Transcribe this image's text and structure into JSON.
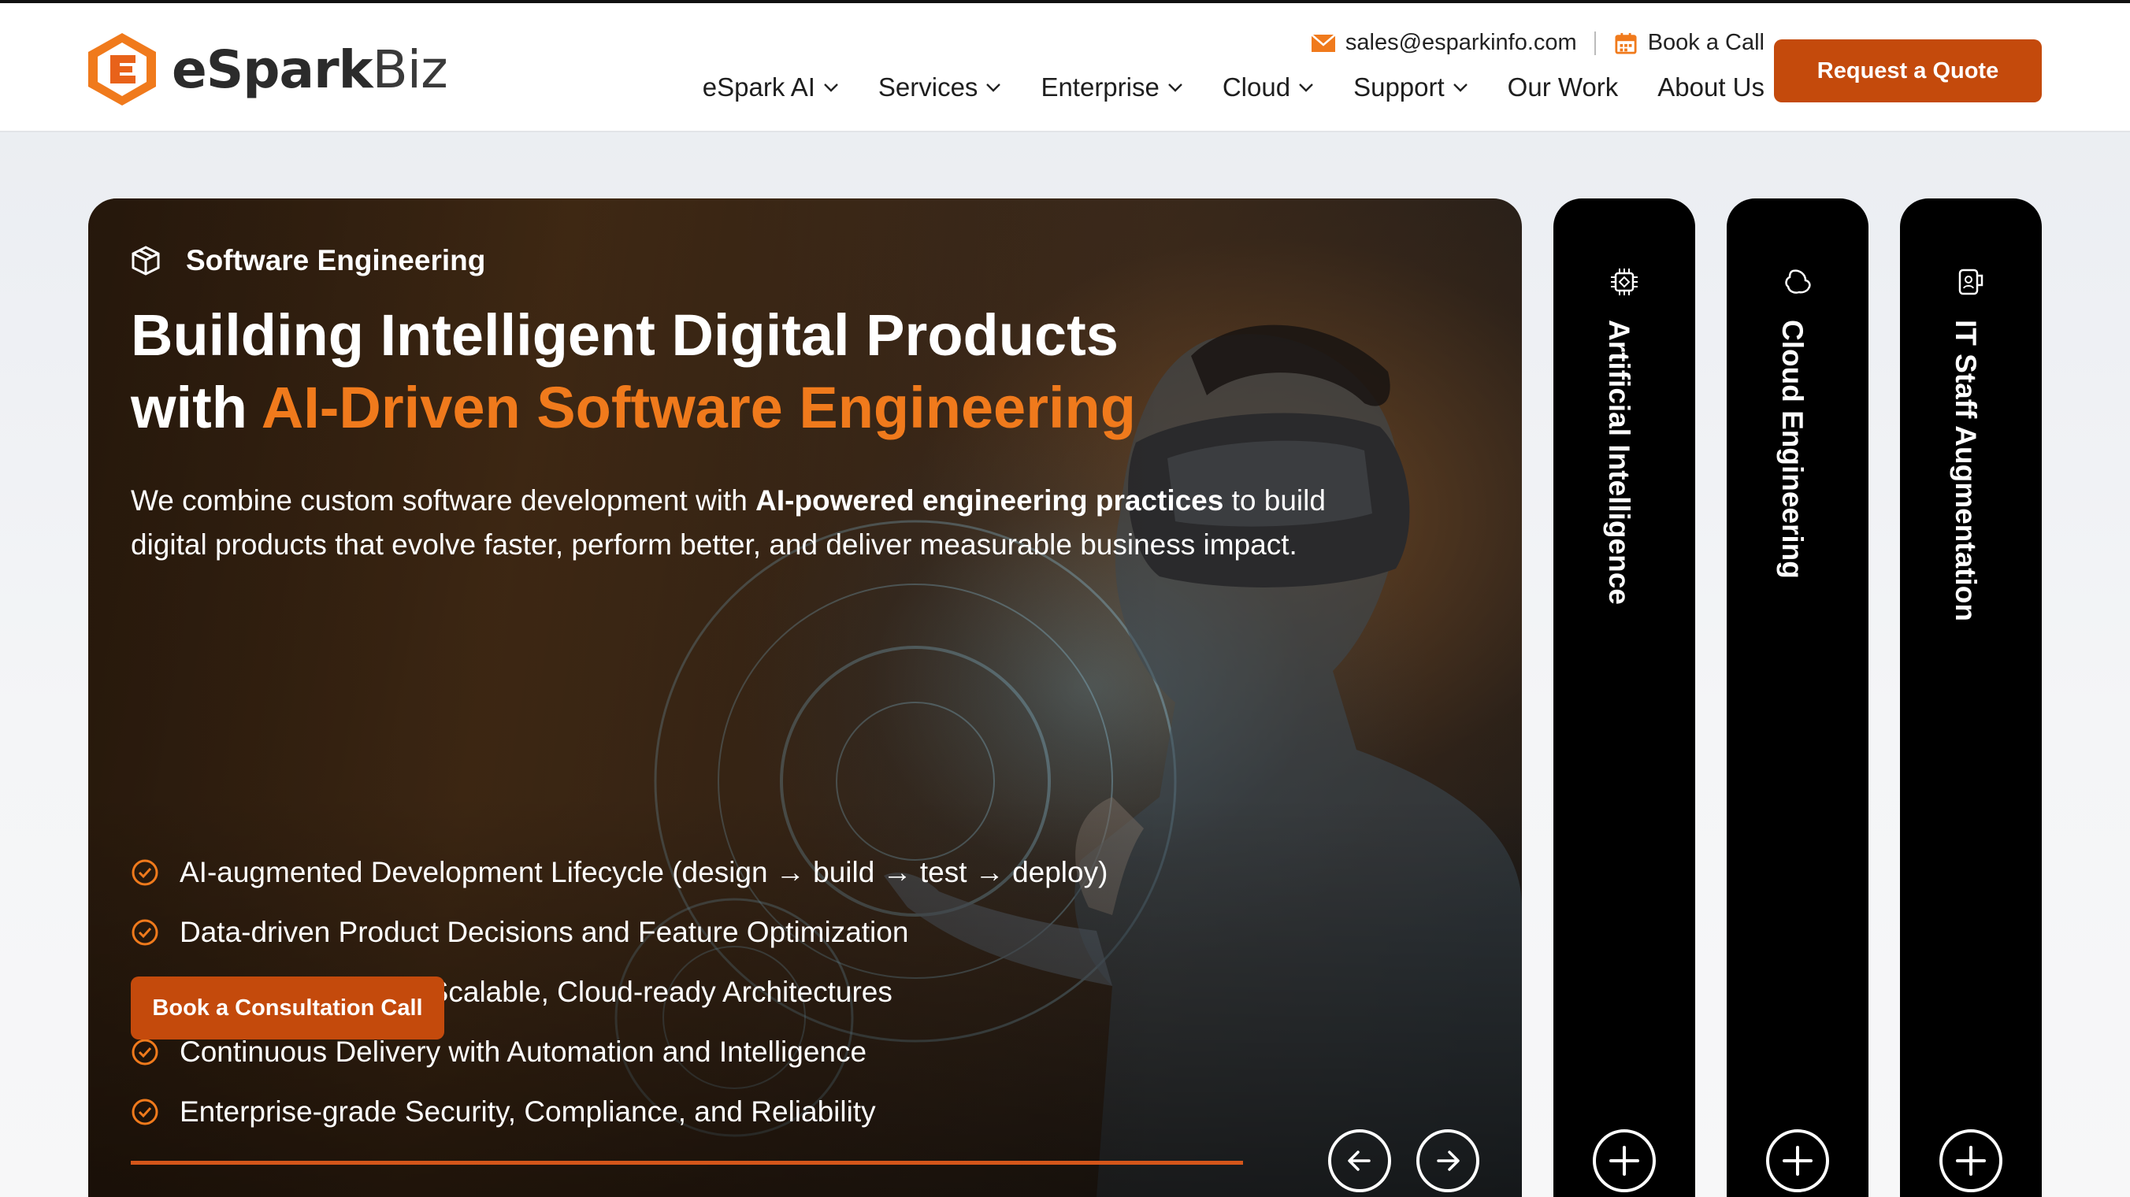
{
  "brand": {
    "name_main": "eSpark",
    "name_suffix": "Biz",
    "accent": "#f07a1c",
    "button_color": "#c44a0c"
  },
  "header": {
    "email": "sales@esparkinfo.com",
    "book_call": "Book a Call",
    "nav": [
      {
        "label": "eSpark AI",
        "dropdown": true
      },
      {
        "label": "Services",
        "dropdown": true
      },
      {
        "label": "Enterprise",
        "dropdown": true
      },
      {
        "label": "Cloud",
        "dropdown": true
      },
      {
        "label": "Support",
        "dropdown": true
      },
      {
        "label": "Our Work",
        "dropdown": false
      },
      {
        "label": "About Us",
        "dropdown": false
      }
    ],
    "quote_button": "Request a Quote"
  },
  "hero": {
    "eyebrow": "Software Engineering",
    "title_line1": "Building Intelligent Digital Products",
    "title_line2_prefix": "with ",
    "title_line2_accent": "AI-Driven Software Engineering",
    "desc_part1": "We combine custom software development with ",
    "desc_bold": "AI-powered engineering practices",
    "desc_part2": " to build digital products that evolve faster, perform better, and deliver measurable business impact.",
    "features": [
      "AI-augmented Development Lifecycle (design → build → test → deploy)",
      "Data-driven Product Decisions and Feature Optimization",
      "High-performance, Scalable, Cloud-ready Architectures",
      "Continuous Delivery with Automation and Intelligence",
      "Enterprise-grade Security, Compliance, and Reliability"
    ],
    "cta": "Book a Consultation Call",
    "slide_progress": 1.0
  },
  "side_panels": [
    {
      "label": "Artificial Intelligence",
      "icon": "chip-icon"
    },
    {
      "label": "Cloud Engineering",
      "icon": "cloud-icon"
    },
    {
      "label": "IT Staff Augmentation",
      "icon": "person-device-icon"
    }
  ]
}
